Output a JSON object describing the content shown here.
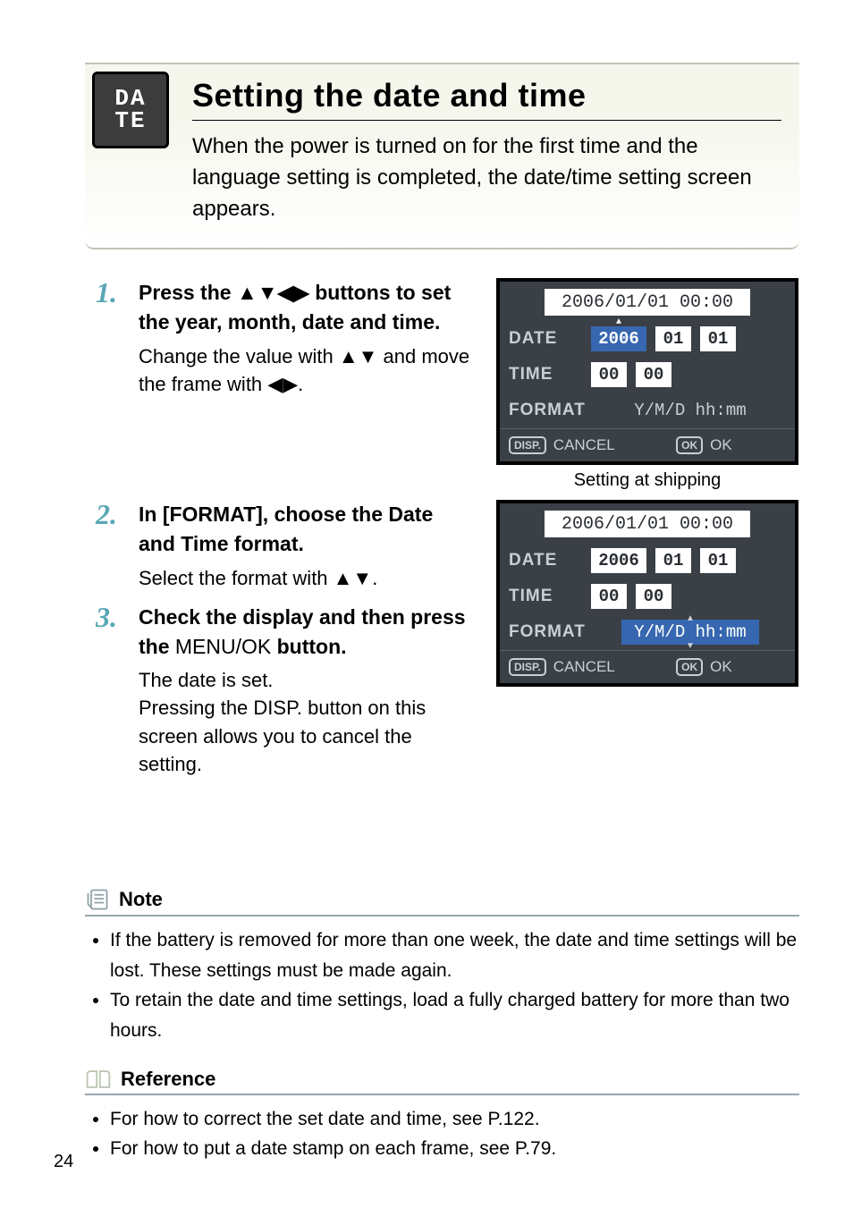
{
  "header": {
    "iconText": "DA\nTE",
    "title": "Setting the date and time",
    "intro": "When the power is turned on for the first time and the language setting is completed, the date/time setting screen appears."
  },
  "steps": [
    {
      "num": "1.",
      "head_pre": "Press the ",
      "head_post": " buttons to set the year, month, date and time.",
      "sub_pre": "Change the value with ",
      "sub_mid": " and move the frame with ",
      "sub_end": "."
    },
    {
      "num": "2.",
      "head": "In [FORMAT], choose the Date and Time format.",
      "sub_pre": "Select the format with ",
      "sub_end": "."
    },
    {
      "num": "3.",
      "head_pre": "Check the display and then press the ",
      "menu_ok": "MENU/OK",
      "head_post": " button.",
      "sub": "The date is set.\nPressing the DISP. button on this screen allows you to cancel the setting."
    }
  ],
  "lcd": {
    "title": "2006/01/01 00:00",
    "rows": {
      "date_label": "DATE",
      "time_label": "TIME",
      "format_label": "FORMAT",
      "date_y": "2006",
      "date_m": "01",
      "date_d": "01",
      "time_h": "00",
      "time_m": "00",
      "format": "Y/M/D hh:mm"
    },
    "foot": {
      "disp": "DISP.",
      "cancel": "CANCEL",
      "ok_btn": "OK",
      "ok": "OK"
    },
    "caption": "Setting at shipping"
  },
  "note": {
    "title": "Note",
    "items": [
      "If the battery is removed for more than one week, the date and time settings will be lost. These settings must be made again.",
      "To retain the date and time settings, load a fully charged battery for more than two hours."
    ]
  },
  "reference": {
    "title": "Reference",
    "items": [
      "For how to correct the set date and time, see P.122.",
      "For how to put a date stamp on each frame, see P.79."
    ]
  },
  "pageNumber": "24"
}
